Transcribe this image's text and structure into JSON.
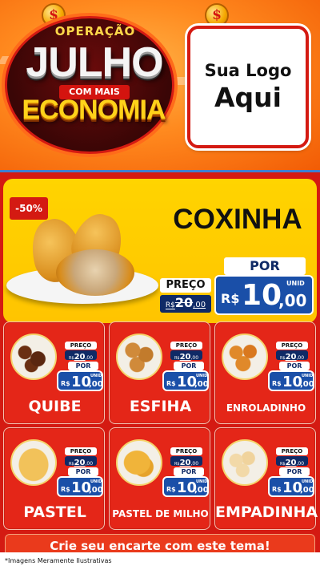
{
  "header": {
    "campaign_top": "OPERAÇÃO",
    "campaign_main": "JULHO",
    "campaign_ribbon": "COM MAIS",
    "campaign_bottom": "ECONOMIA",
    "coin_symbol": "$",
    "logo_line1": "Sua Logo",
    "logo_line2": "Aqui"
  },
  "hero": {
    "discount": "-50%",
    "title": "COXINHA",
    "old_label": "PREÇO",
    "old_price_rs": "R$",
    "old_price_int": "20",
    "old_price_cents": ",00",
    "por_label": "POR",
    "new_rs": "R$",
    "new_int": "10",
    "new_cents": ",00",
    "unit": "UNID"
  },
  "products": [
    {
      "name": "QUIBE",
      "old_label": "PREÇO",
      "old_rs": "R$",
      "old_int": "20",
      "old_cents": ",00",
      "por": "POR",
      "new_rs": "R$",
      "new_int": "10",
      "new_cents": ",00",
      "unit": "UNID"
    },
    {
      "name": "ESFIHA",
      "old_label": "PREÇO",
      "old_rs": "R$",
      "old_int": "20",
      "old_cents": ",00",
      "por": "POR",
      "new_rs": "R$",
      "new_int": "10",
      "new_cents": ",00",
      "unit": "UNID"
    },
    {
      "name": "ENROLADINHO",
      "old_label": "PREÇO",
      "old_rs": "R$",
      "old_int": "20",
      "old_cents": ",00",
      "por": "POR",
      "new_rs": "R$",
      "new_int": "10",
      "new_cents": ",00",
      "unit": "UNID"
    },
    {
      "name": "PASTEL",
      "old_label": "PREÇO",
      "old_rs": "R$",
      "old_int": "20",
      "old_cents": ",00",
      "por": "POR",
      "new_rs": "R$",
      "new_int": "10",
      "new_cents": ",00",
      "unit": "UNID"
    },
    {
      "name": "PASTEL DE MILHO",
      "old_label": "PREÇO",
      "old_rs": "R$",
      "old_int": "20",
      "old_cents": ",00",
      "por": "POR",
      "new_rs": "R$",
      "new_int": "10",
      "new_cents": ",00",
      "unit": "UNID"
    },
    {
      "name": "EMPADINHA",
      "old_label": "PREÇO",
      "old_rs": "R$",
      "old_int": "20",
      "old_cents": ",00",
      "por": "POR",
      "new_rs": "R$",
      "new_int": "10",
      "new_cents": ",00",
      "unit": "UNID"
    }
  ],
  "footer": {
    "cta": "Crie seu encarte com este tema!",
    "disclaimer": "*Imagens Meramente Ilustrativas"
  },
  "colors": {
    "brand_red": "#d41a12",
    "hero_yellow": "#ffd400",
    "price_blue": "#1a4fa8",
    "navy": "#0f2a66"
  }
}
